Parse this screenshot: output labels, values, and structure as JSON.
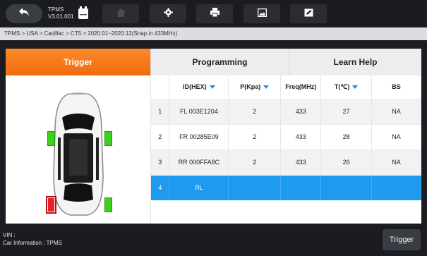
{
  "app": {
    "name": "TPMS",
    "version": "V3.01.001"
  },
  "toolbar": {
    "back": "back-arrow",
    "icons": [
      "home-icon",
      "settings-icon",
      "print-icon",
      "screenshot-icon",
      "edit-icon"
    ]
  },
  "breadcrumb": "TPMS > USA > Cadillac > CT5 > 2020.01~2020.12(Snap in 433MHz)",
  "tabs": [
    {
      "label": "Trigger",
      "active": true
    },
    {
      "label": "Programming",
      "active": false
    },
    {
      "label": "Learn Help",
      "active": false
    }
  ],
  "table": {
    "columns": [
      "",
      "ID(HEX)",
      "P(Kpa)",
      "Freq(MHz)",
      "T(℃)",
      "BS"
    ],
    "rows": [
      {
        "n": "1",
        "id": "FL  003E1204",
        "p": "2",
        "freq": "433",
        "t": "27",
        "bs": "NA"
      },
      {
        "n": "2",
        "id": "FR  00285E09",
        "p": "2",
        "freq": "433",
        "t": "28",
        "bs": "NA"
      },
      {
        "n": "3",
        "id": "RR  000FFA8C",
        "p": "2",
        "freq": "433",
        "t": "26",
        "bs": "NA"
      },
      {
        "n": "4",
        "id": "RL",
        "p": "",
        "freq": "",
        "t": "",
        "bs": ""
      }
    ]
  },
  "tires": {
    "FL": "#3ecf1f",
    "FR": "#3ecf1f",
    "RR": "#3ecf1f",
    "RL": "#e8202a"
  },
  "footer": {
    "vin": "VIN :",
    "car_info": "Car Information : TPMS",
    "trigger_label": "Trigger"
  }
}
